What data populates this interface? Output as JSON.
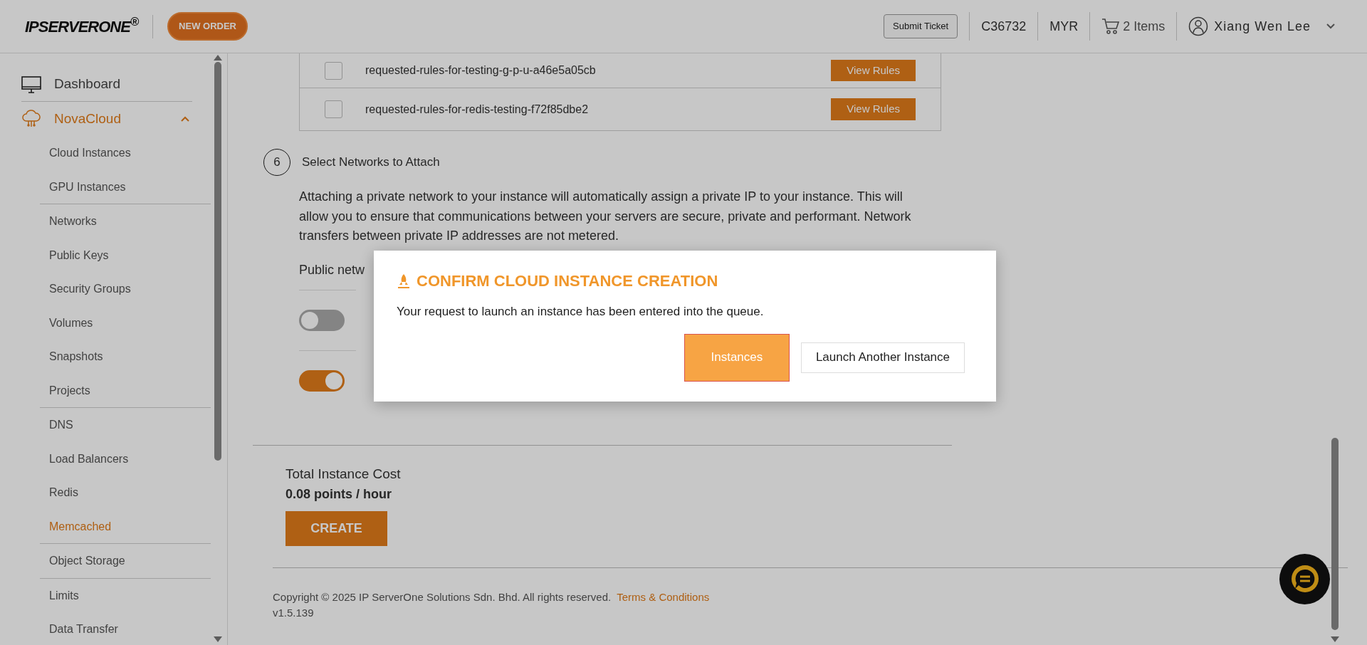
{
  "header": {
    "logo": "IPSERVERONE$^{®}$",
    "new_order": "NEW ORDER",
    "submit_ticket": "Submit Ticket",
    "account": "C36732",
    "currency": "MYR",
    "cart": "2 Items",
    "user": "Xiang Wen Lee"
  },
  "sidebar": {
    "items": [
      {
        "label": "Dashboard",
        "kind": "dashboard",
        "selected": false
      },
      {
        "label": "NovaCloud",
        "kind": "cloud",
        "selected": true,
        "expanded": true,
        "groups": [
          [
            {
              "label": "Cloud Instances",
              "selected": false
            },
            {
              "label": "GPU Instances",
              "selected": false
            }
          ],
          [
            {
              "label": "Networks",
              "selected": false
            },
            {
              "label": "Public Keys",
              "selected": false
            },
            {
              "label": "Security Groups",
              "selected": false
            },
            {
              "label": "Volumes",
              "selected": false
            },
            {
              "label": "Snapshots",
              "selected": false
            },
            {
              "label": "Projects",
              "selected": false
            }
          ],
          [
            {
              "label": "DNS",
              "selected": false
            },
            {
              "label": "Load Balancers",
              "selected": false
            },
            {
              "label": "Redis",
              "selected": false
            },
            {
              "label": "Memcached",
              "selected": true
            }
          ],
          [
            {
              "label": "Object Storage",
              "selected": false
            }
          ],
          [
            {
              "label": "Limits",
              "selected": false
            },
            {
              "label": "Data Transfer",
              "selected": false
            }
          ]
        ]
      }
    ]
  },
  "security_rules": [
    {
      "name": "requested-rules-for-testing-g-p-u-a46e5a05cb",
      "checked": false,
      "button": "View Rules"
    },
    {
      "name": "requested-rules-for-redis-testing-f72f85dbe2",
      "checked": false,
      "button": "View Rules"
    }
  ],
  "step": {
    "number": "6",
    "title": "Select Networks to Attach",
    "description": "Attaching a private network to your instance will automatically assign a private IP to your instance. This will allow you to ensure that communications between your servers are secure, private and performant. Network transfers between private IP addresses are not metered.",
    "public_note": "Public netw",
    "toggles": [
      {
        "on": false
      },
      {
        "on": true
      }
    ]
  },
  "cost": {
    "label": "Total Instance Cost",
    "value": "0.08 points / hour",
    "button": "CREATE"
  },
  "footer": {
    "copyright": "Copyright © 2025 IP ServerOne Solutions Sdn. Bhd. All rights reserved.",
    "link": "Terms & Conditions",
    "version": "v1.5.139"
  },
  "modal": {
    "title": "CONFIRM CLOUD INSTANCE CREATION",
    "message": "Your request to launch an instance has been entered into the queue.",
    "buttons": [
      {
        "label": "Instances",
        "kind": "primary",
        "focused": true
      },
      {
        "label": "Launch Another Instance",
        "kind": "secondary",
        "focused": false
      }
    ]
  }
}
